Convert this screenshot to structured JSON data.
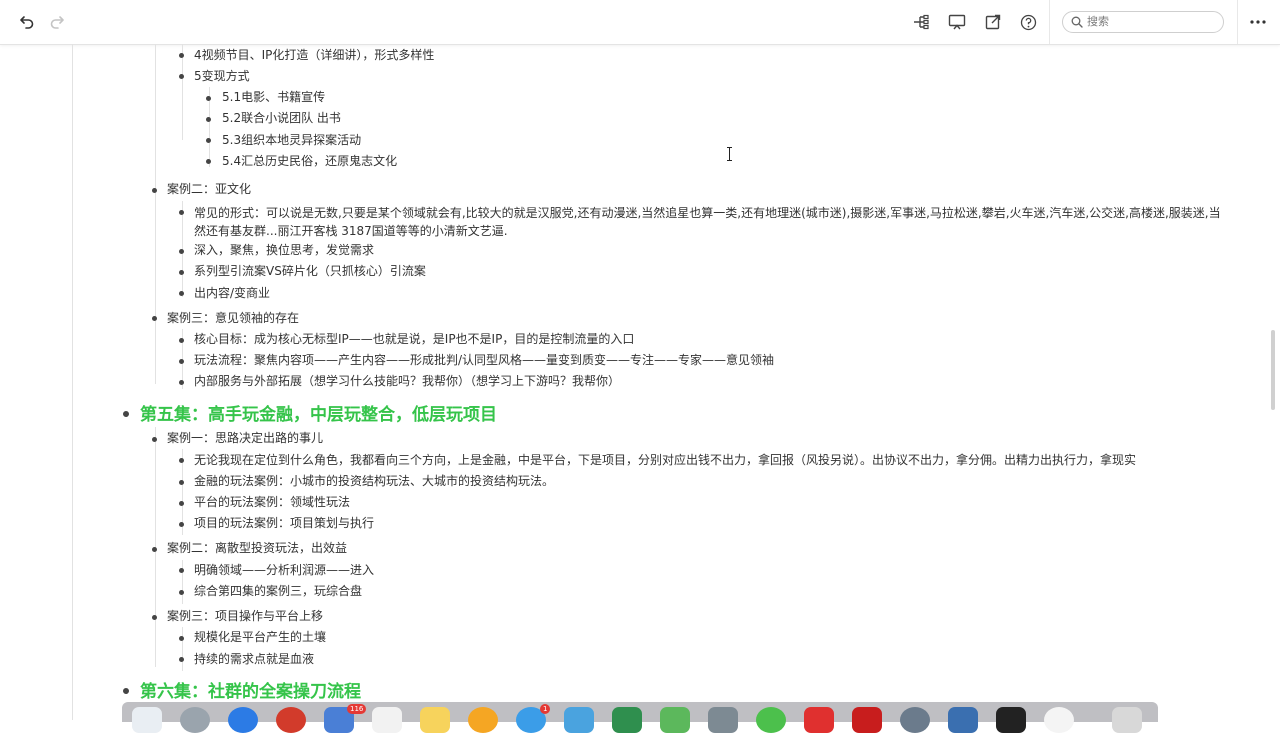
{
  "toolbar": {
    "search_placeholder": "搜索",
    "icons": [
      "undo-icon",
      "redo-icon",
      "outline-icon",
      "present-icon",
      "export-icon",
      "help-icon",
      "more-icon"
    ]
  },
  "outline": {
    "top_items": [
      "4视频节目、IP化打造（详细讲），形式多样性",
      "5变现方式"
    ],
    "monetize_items": [
      "5.1电影、书籍宣传",
      "5.2联合小说团队 出书",
      "5.3组织本地灵异探案活动",
      "5.4汇总历史民俗，还原鬼志文化"
    ],
    "case2": {
      "title": "案例二：亚文化",
      "items": [
        "常见的形式：可以说是无数,只要是某个领域就会有,比较大的就是汉服党,还有动漫迷,当然追星也算一类,还有地理迷(城市迷),摄影迷,军事迷,马拉松迷,攀岩,火车迷,汽车迷,公交迷,高楼迷,服装迷,当然还有基友群...丽江开客栈 3187国道等等的小清新文艺逼.",
        "深入，聚焦，换位思考，发觉需求",
        "系列型引流案VS碎片化（只抓核心）引流案",
        "出内容/变商业"
      ]
    },
    "case3": {
      "title": "案例三：意见领袖的存在",
      "items": [
        "核心目标：成为核心无标型IP——也就是说，是IP也不是IP，目的是控制流量的入口",
        "玩法流程：聚焦内容项——产生内容——形成批判/认同型风格——量变到质变——专注——专家——意见领袖",
        "内部服务与外部拓展（想学习什么技能吗？我帮你）（想学习上下游吗？我帮你）"
      ]
    },
    "episode5": {
      "title": "第五集：高手玩金融，中层玩整合，低层玩项目",
      "case1": {
        "title": "案例一：思路决定出路的事儿",
        "items": [
          "无论我现在定位到什么角色，我都看向三个方向，上是金融，中是平台，下是项目，分别对应出钱不出力，拿回报（风投另说）。出协议不出力，拿分佣。出精力出执行力，拿现实",
          "金融的玩法案例：小城市的投资结构玩法、大城市的投资结构玩法。",
          "平台的玩法案例：领域性玩法",
          "项目的玩法案例：项目策划与执行"
        ]
      },
      "case2": {
        "title": "案例二：离散型投资玩法，出效益",
        "items": [
          "明确领域——分析利润源——进入",
          "综合第四集的案例三，玩综合盘"
        ]
      },
      "case3": {
        "title": "案例三：项目操作与平台上移",
        "items": [
          "规模化是平台产生的土壤",
          "持续的需求点就是血液"
        ]
      }
    },
    "episode6": {
      "title": "第六集：社群的全案操刀流程"
    }
  },
  "colors": {
    "heading": "#35c44a",
    "text": "#333333",
    "toolbar_border": "#e4e4e4"
  },
  "dock": {
    "badges": [
      "116",
      "1"
    ]
  }
}
